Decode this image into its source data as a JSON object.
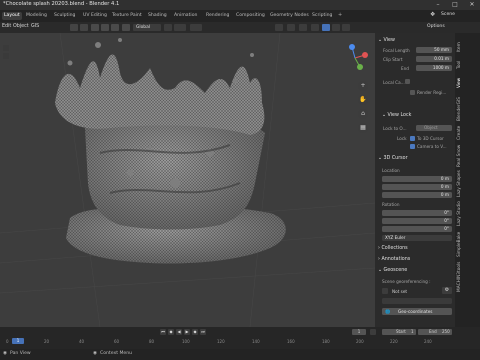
{
  "window": {
    "title": "*Chocolate splash 20203.blend - Blender 4.1"
  },
  "workspace_tabs": [
    "Layout",
    "Modeling",
    "Sculpting",
    "UV Editing",
    "Texture Paint",
    "Shading",
    "Animation",
    "Rendering",
    "Compositing",
    "Geometry Nodes",
    "Scripting"
  ],
  "scene": {
    "name": "Scene"
  },
  "header": {
    "menus": [
      "Edit",
      "Object",
      "GIS"
    ],
    "transform_orientation": "Global",
    "options_label": "Options"
  },
  "sidebar": {
    "view_section": "View",
    "focal_length_label": "Focal Length",
    "focal_length_value": "50 mm",
    "clip_start_label": "Clip Start",
    "clip_start_value": "0.01 m",
    "clip_end_label": "End",
    "clip_end_value": "1000 m",
    "local_camera_label": "Local Ca...",
    "render_region_label": "Render Regi...",
    "view_lock_section": "View Lock",
    "lock_to_object_label": "Lock to O...",
    "lock_to_object_placeholder": "Object",
    "lock_label": "Lock",
    "to_3d_cursor_label": "To 3D Cursor",
    "camera_to_view_label": "Camera to V...",
    "cursor_section": "3D Cursor",
    "location_label": "Location",
    "x_label": "X",
    "y_label": "Y",
    "z_label": "Z",
    "loc_x": "0 m",
    "loc_y": "0 m",
    "loc_z": "0 m",
    "rotation_label": "Rotation",
    "rot_x": "0°",
    "rot_y": "0°",
    "rot_z": "0°",
    "rotation_mode": "XYZ Euler",
    "collections_section": "Collections",
    "annotations_section": "Annotations",
    "geoscene_section": "Geoscene",
    "georef_label": "Scene georeferencing :",
    "not_set_label": "Not set",
    "geo_coordinates_label": "Geo-coordinates"
  },
  "side_tabs": [
    "Item",
    "Tool",
    "View",
    "BlenderGIS",
    "Create",
    "Real Snow",
    "Lazy Shapes",
    "Lazy Studio",
    "SimpleBake",
    "MACHIN3tools"
  ],
  "timeline": {
    "frame_current": "1",
    "start_label": "Start",
    "start_value": "1",
    "end_label": "End",
    "end_value": "250",
    "ticks": [
      "0",
      "20",
      "40",
      "60",
      "80",
      "100",
      "120",
      "140",
      "160",
      "180",
      "200",
      "220",
      "240"
    ]
  },
  "statusbar": {
    "left_action": "Pan View",
    "right_action": "Context Menu"
  },
  "colors": {
    "accent": "#4672b8",
    "viewport_bg": "#3d3d3d"
  }
}
